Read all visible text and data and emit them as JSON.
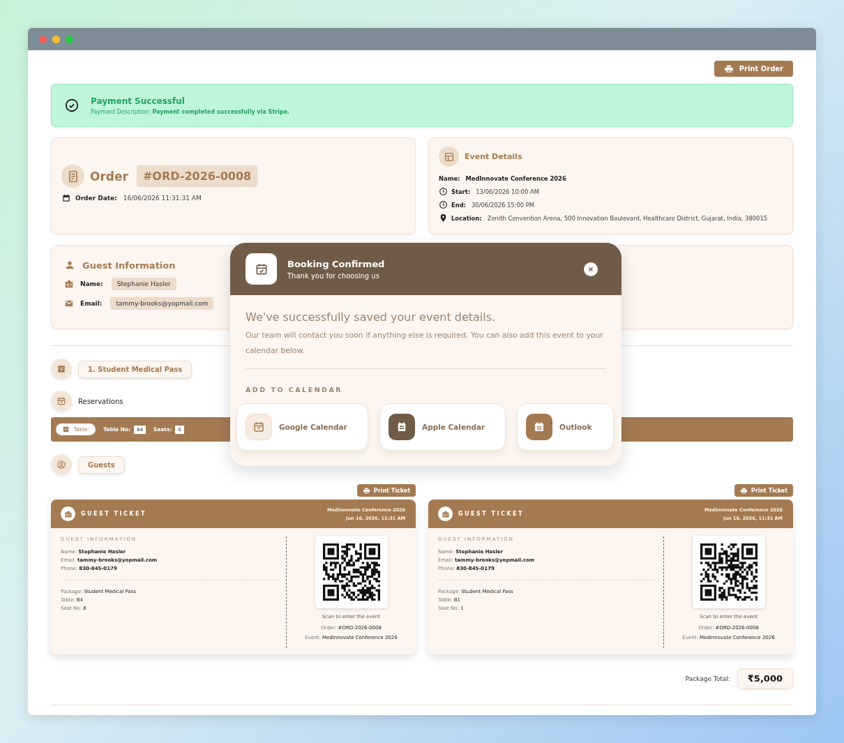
{
  "print_order_button": "Print Order",
  "payment_alert": {
    "title": "Payment Successful",
    "description": "Payment Description: **Payment completed successfully via Stripe.**"
  },
  "order": {
    "label": "Order",
    "number": "#ORD-2026-0008",
    "date_label": "Order Date:",
    "date": "16/06/2026 11:31:31 AM"
  },
  "event_details": {
    "title": "Event Details",
    "fields": [
      {
        "kind": "name",
        "label": "Name:",
        "value": "MedInnovate Conference 2026"
      },
      {
        "kind": "clock",
        "label": "Start:",
        "value": "13/06/2026 10:00 AM"
      },
      {
        "kind": "clock",
        "label": "End:",
        "value": "30/06/2026 15:00 PM"
      },
      {
        "kind": "pin",
        "label": "Location:",
        "value": "Zenith Convention Arena, 500 Innovation Boulevard, Healthcare District, Gujarat, India, 380015"
      }
    ]
  },
  "guest_information": {
    "title": "Guest Information",
    "fields": [
      {
        "kind": "badge",
        "label": "Name:",
        "value": "Stephanie Hasler"
      },
      {
        "kind": "mail",
        "label": "Email:",
        "value": "tammy-brooks@yopmail.com"
      }
    ]
  },
  "package": {
    "title": "1. Student Medical Pass"
  },
  "reservations": {
    "title": "Reservations",
    "type_label": "Table:",
    "table_no_label": "Table No:",
    "table_no": "B4",
    "seats_label": "Seats:",
    "seats": "8"
  },
  "guests_button": "Guests",
  "tickets": [
    {
      "print_button": "Print Ticket",
      "title": "GUEST TICKET",
      "event": "MedInnovate Conference 2026",
      "date": "Jun 16, 2026, 11:31 AM",
      "section_title": "GUEST INFORMATION",
      "info": [
        {
          "label": "Name:",
          "value": "Stephanie Hasler"
        },
        {
          "label": "Email:",
          "value": "tammy-brooks@yopmail.com"
        },
        {
          "label": "Phone:",
          "value": "830-845-0179"
        }
      ],
      "details": [
        {
          "label": "Package:",
          "value": "Student Medical Pass"
        },
        {
          "label": "Table:",
          "value": "B4"
        },
        {
          "label": "Seat No:",
          "value": "8"
        }
      ],
      "scan_caption": "Scan to enter the event",
      "order_label": "Order:",
      "order": "#ORD-2026-0008",
      "event_label": "Event:",
      "event_value": "MedInnovate Conference 2026"
    },
    {
      "print_button": "Print Ticket",
      "title": "GUEST TICKET",
      "event": "MedInnovate Conference 2026",
      "date": "Jun 16, 2026, 11:31 AM",
      "section_title": "GUEST INFORMATION",
      "info": [
        {
          "label": "Name:",
          "value": "Stephanie Hasler"
        },
        {
          "label": "Email:",
          "value": "tammy-brooks@yopmail.com"
        },
        {
          "label": "Phone:",
          "value": "830-845-0179"
        }
      ],
      "details": [
        {
          "label": "Package:",
          "value": "Student Medical Pass"
        },
        {
          "label": "Table:",
          "value": "B1"
        },
        {
          "label": "Seat No:",
          "value": "1"
        }
      ],
      "scan_caption": "Scan to enter the event",
      "order_label": "Order:",
      "order": "#ORD-2026-0008",
      "event_label": "Event:",
      "event_value": "MedInnovate Conference 2026"
    }
  ],
  "package_total": {
    "label": "Package Total:",
    "amount": "₹5,000"
  },
  "modal": {
    "title": "Booking Confirmed",
    "subtitle": "Thank you for choosing us",
    "heading": "We've successfully saved your event details.",
    "body": "Our team will contact you soon if anything else is required. You can also add this event to your calendar below.",
    "section_label": "ADD TO CALENDAR",
    "options": [
      {
        "kind": "google",
        "label": "Google Calendar"
      },
      {
        "kind": "apple",
        "label": "Apple Calendar"
      },
      {
        "kind": "outlook",
        "label": "Outlook"
      }
    ]
  }
}
